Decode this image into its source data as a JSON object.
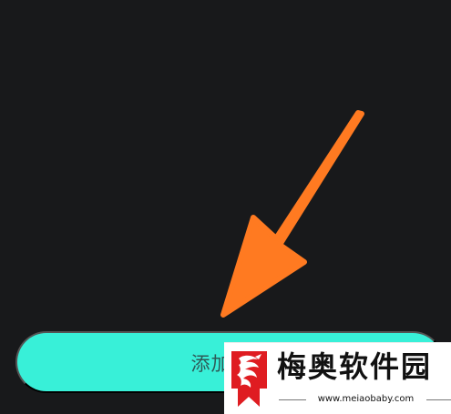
{
  "add_button": {
    "label": "添加"
  },
  "watermark": {
    "name": "梅奥软件园",
    "url": "www.meiaobaby.com"
  },
  "colors": {
    "background": "#18191b",
    "button": "#38f0d8",
    "arrow": "#ff7a21",
    "watermark_red": "#df1c21"
  }
}
